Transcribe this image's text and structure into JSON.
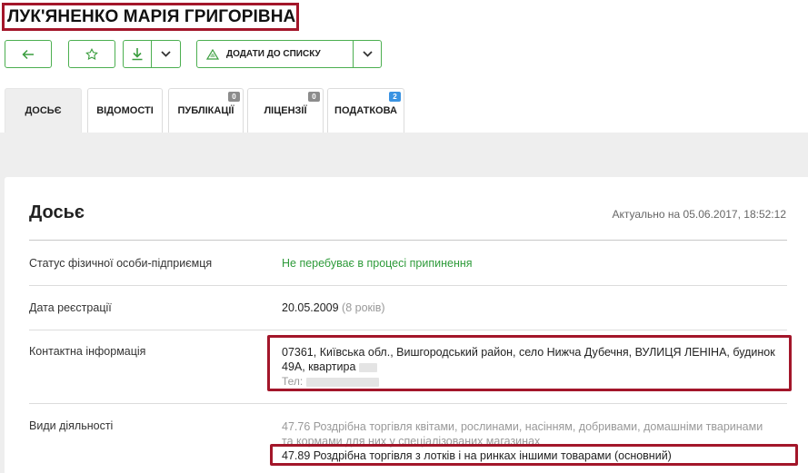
{
  "header": {
    "title": "ЛУК'ЯНЕНКО МАРІЯ ГРИГОРІВНА"
  },
  "toolbar": {
    "back_icon": "arrow-left-icon",
    "star_icon": "star-icon",
    "download_icon": "download-icon",
    "add_to_list_label": "ДОДАТИ ДО СПИСКУ",
    "accent_color": "#4caf50"
  },
  "tabs": [
    {
      "label": "ДОСЬЄ",
      "active": true,
      "badge": ""
    },
    {
      "label": "ВІДОМОСТІ",
      "active": false,
      "badge": ""
    },
    {
      "label": "ПУБЛІКАЦІЇ",
      "active": false,
      "badge": "0"
    },
    {
      "label": "ЛІЦЕНЗІЇ",
      "active": false,
      "badge": "0"
    },
    {
      "label": "ПОДАТКОВА",
      "active": false,
      "badge": "2"
    }
  ],
  "dossier": {
    "heading": "Досьє",
    "updated": "Актуально на 05.06.2017, 18:52:12",
    "rows": {
      "status": {
        "label": "Статус фізичної особи-підприємця",
        "value": "Не перебуває в процесі припинення"
      },
      "reg_date": {
        "label": "Дата реєстрації",
        "value": "20.05.2009",
        "note": "(8 років)"
      },
      "contact": {
        "label": "Контактна інформація",
        "address_line1": "07361, Київська обл., Вишгородський район, село Нижча Дубечня, ВУЛИЦЯ ЛЕНІНА, будинок",
        "address_line2": "49А, квартира",
        "phone_label": "Тел:"
      },
      "activities": {
        "label": "Види діяльності",
        "item1_line1": "47.76 Роздрібна торгівля квітами, рослинами, насінням, добривами, домашніми тваринами",
        "item1_line2": "та кормами для них у спеціалізованих магазинах",
        "item2": "47.89 Роздрібна торгівля з лотків і на ринках іншими товарами (основний)"
      }
    }
  },
  "colors": {
    "highlight": "#a3162a",
    "status_green": "#2e9b3a",
    "badge_blue": "#3a93e2",
    "badge_grey": "#8c8c8c"
  }
}
